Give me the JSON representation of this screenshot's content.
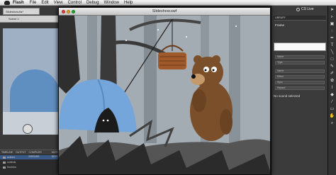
{
  "menubar": {
    "app_name": "Flash",
    "items": [
      "File",
      "Edit",
      "View",
      "Control",
      "Debug",
      "Window",
      "Help"
    ]
  },
  "left": {
    "doc_tab": "Slideshow.fla*",
    "scene": "Scene 1"
  },
  "timeline": {
    "tabs": [
      "TIMELINE",
      "OUTPUT",
      "COMPILER ERRORS",
      "MOTION EDITOR"
    ],
    "layers": [
      "actions",
      "controls",
      "Screens"
    ]
  },
  "window": {
    "title": "Slideshow.swf"
  },
  "right": {
    "cs_live": "CS Live",
    "panel_tab": "LIBRARY",
    "frame_label": "Frame",
    "prop_rows": [
      "Name",
      "Type",
      "Name",
      "Effect",
      "Sync",
      "Repeat"
    ],
    "no_sound": "No sound selected"
  },
  "tools": [
    "arrow-icon",
    "subselect-icon",
    "free-transform-icon",
    "lasso-icon",
    "pen-icon",
    "text-icon",
    "line-icon",
    "rect-icon",
    "pencil-icon",
    "brush-icon",
    "deco-icon",
    "bone-icon",
    "paint-bucket-icon",
    "eyedropper-icon",
    "eraser-icon",
    "hand-icon",
    "zoom-icon"
  ],
  "colors": {
    "sky": "#9ea7b0",
    "tent": "#6e9ed4",
    "bear": "#7a4f2a",
    "foliage_dark": "#2b2b2b"
  }
}
